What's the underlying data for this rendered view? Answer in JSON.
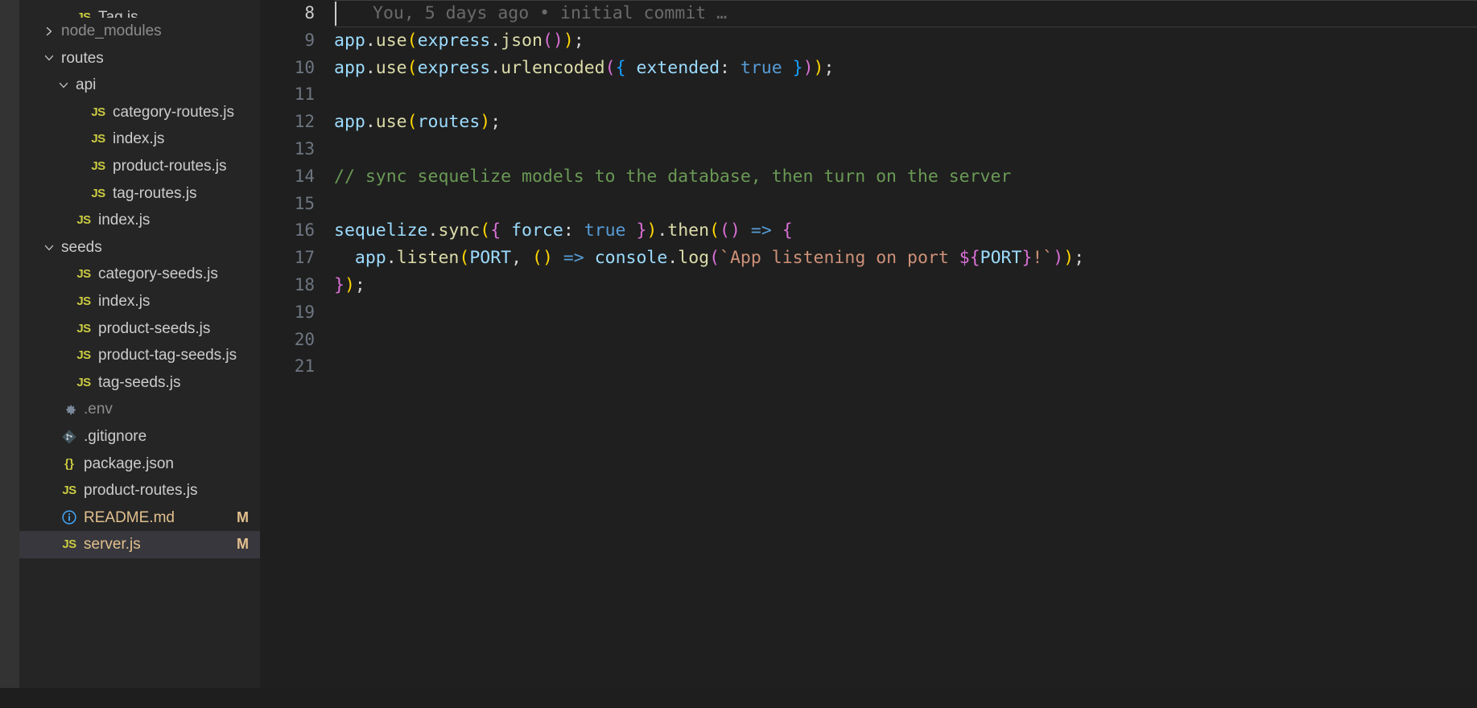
{
  "window": {
    "theme": "Dark+ (default dark)",
    "background": "#1e1e1e",
    "sidebar_background": "#252526",
    "editor_background": "#1f1f1f",
    "selection_background": "#37373d",
    "modified_badge_color": "#e2c08d",
    "accent_blue": "#0c7d9d"
  },
  "sidebar": {
    "name": "explorer-file-tree",
    "items": [
      {
        "label": "Tag.js",
        "icon": "js-file-icon",
        "indent": 2,
        "kind": "file",
        "badge": "",
        "state": ""
      },
      {
        "label": "node_modules",
        "icon": "chevron-right-icon",
        "indent": 1,
        "kind": "folder-collapsed",
        "badge": "",
        "state": "dim"
      },
      {
        "label": "routes",
        "icon": "chevron-down-icon",
        "indent": 1,
        "kind": "folder-expanded",
        "badge": "",
        "state": ""
      },
      {
        "label": "api",
        "icon": "chevron-down-icon",
        "indent": 2,
        "kind": "folder-expanded",
        "badge": "",
        "state": ""
      },
      {
        "label": "category-routes.js",
        "icon": "js-file-icon",
        "indent": 3,
        "kind": "file",
        "badge": "",
        "state": ""
      },
      {
        "label": "index.js",
        "icon": "js-file-icon",
        "indent": 3,
        "kind": "file",
        "badge": "",
        "state": ""
      },
      {
        "label": "product-routes.js",
        "icon": "js-file-icon",
        "indent": 3,
        "kind": "file",
        "badge": "",
        "state": ""
      },
      {
        "label": "tag-routes.js",
        "icon": "js-file-icon",
        "indent": 3,
        "kind": "file",
        "badge": "",
        "state": ""
      },
      {
        "label": "index.js",
        "icon": "js-file-icon",
        "indent": 2,
        "kind": "file",
        "badge": "",
        "state": ""
      },
      {
        "label": "seeds",
        "icon": "chevron-down-icon",
        "indent": 1,
        "kind": "folder-expanded",
        "badge": "",
        "state": ""
      },
      {
        "label": "category-seeds.js",
        "icon": "js-file-icon",
        "indent": 2,
        "kind": "file",
        "badge": "",
        "state": ""
      },
      {
        "label": "index.js",
        "icon": "js-file-icon",
        "indent": 2,
        "kind": "file",
        "badge": "",
        "state": ""
      },
      {
        "label": "product-seeds.js",
        "icon": "js-file-icon",
        "indent": 2,
        "kind": "file",
        "badge": "",
        "state": ""
      },
      {
        "label": "product-tag-seeds.js",
        "icon": "js-file-icon",
        "indent": 2,
        "kind": "file",
        "badge": "",
        "state": ""
      },
      {
        "label": "tag-seeds.js",
        "icon": "js-file-icon",
        "indent": 2,
        "kind": "file",
        "badge": "",
        "state": ""
      },
      {
        "label": ".env",
        "icon": "gear-icon",
        "indent": 1,
        "kind": "file",
        "badge": "",
        "state": "dim"
      },
      {
        "label": ".gitignore",
        "icon": "git-icon",
        "indent": 1,
        "kind": "file",
        "badge": "",
        "state": ""
      },
      {
        "label": "package.json",
        "icon": "json-braces-icon",
        "indent": 1,
        "kind": "file",
        "badge": "",
        "state": ""
      },
      {
        "label": "product-routes.js",
        "icon": "js-file-icon",
        "indent": 1,
        "kind": "file",
        "badge": "",
        "state": ""
      },
      {
        "label": "README.md",
        "icon": "info-circle-icon",
        "indent": 1,
        "kind": "file",
        "badge": "M",
        "state": "modified"
      },
      {
        "label": "server.js",
        "icon": "js-file-icon",
        "indent": 1,
        "kind": "file",
        "badge": "M",
        "state": "modified selected"
      }
    ]
  },
  "editor": {
    "name": "code-editor-server-js",
    "active_line": 8,
    "first_visible_line": 8,
    "lines": [
      {
        "number": "8",
        "active": true,
        "changed": false,
        "blame": "You, 5 days ago • initial commit …",
        "tokens": []
      },
      {
        "number": "9",
        "active": false,
        "changed": false,
        "tokens": [
          {
            "t": "app",
            "c": "t-var"
          },
          {
            "t": ".",
            "c": "t-plain"
          },
          {
            "t": "use",
            "c": "t-fn"
          },
          {
            "t": "(",
            "c": "t-p1"
          },
          {
            "t": "express",
            "c": "t-var"
          },
          {
            "t": ".",
            "c": "t-plain"
          },
          {
            "t": "json",
            "c": "t-fn"
          },
          {
            "t": "(",
            "c": "t-p2"
          },
          {
            "t": ")",
            "c": "t-p2"
          },
          {
            "t": ")",
            "c": "t-p1"
          },
          {
            "t": ";",
            "c": "t-plain"
          }
        ]
      },
      {
        "number": "10",
        "active": false,
        "changed": false,
        "tokens": [
          {
            "t": "app",
            "c": "t-var"
          },
          {
            "t": ".",
            "c": "t-plain"
          },
          {
            "t": "use",
            "c": "t-fn"
          },
          {
            "t": "(",
            "c": "t-p1"
          },
          {
            "t": "express",
            "c": "t-var"
          },
          {
            "t": ".",
            "c": "t-plain"
          },
          {
            "t": "urlencoded",
            "c": "t-fn"
          },
          {
            "t": "(",
            "c": "t-p2"
          },
          {
            "t": "{",
            "c": "t-p3"
          },
          {
            "t": " extended",
            "c": "t-var"
          },
          {
            "t": ": ",
            "c": "t-plain"
          },
          {
            "t": "true",
            "c": "t-kw"
          },
          {
            "t": " ",
            "c": "t-plain"
          },
          {
            "t": "}",
            "c": "t-p3"
          },
          {
            "t": ")",
            "c": "t-p2"
          },
          {
            "t": ")",
            "c": "t-p1"
          },
          {
            "t": ";",
            "c": "t-plain"
          }
        ]
      },
      {
        "number": "11",
        "active": false,
        "changed": false,
        "tokens": []
      },
      {
        "number": "12",
        "active": false,
        "changed": false,
        "tokens": [
          {
            "t": "app",
            "c": "t-var"
          },
          {
            "t": ".",
            "c": "t-plain"
          },
          {
            "t": "use",
            "c": "t-fn"
          },
          {
            "t": "(",
            "c": "t-p1"
          },
          {
            "t": "routes",
            "c": "t-var"
          },
          {
            "t": ")",
            "c": "t-p1"
          },
          {
            "t": ";",
            "c": "t-plain"
          }
        ]
      },
      {
        "number": "13",
        "active": false,
        "changed": false,
        "tokens": []
      },
      {
        "number": "14",
        "active": false,
        "changed": false,
        "tokens": [
          {
            "t": "// sync sequelize models to the database, then turn on the server",
            "c": "t-comment"
          }
        ]
      },
      {
        "number": "15",
        "active": false,
        "changed": false,
        "tokens": []
      },
      {
        "number": "16",
        "active": false,
        "changed": true,
        "tokens": [
          {
            "t": "sequelize",
            "c": "t-var"
          },
          {
            "t": ".",
            "c": "t-plain"
          },
          {
            "t": "sync",
            "c": "t-fn"
          },
          {
            "t": "(",
            "c": "t-p1"
          },
          {
            "t": "{",
            "c": "t-p2"
          },
          {
            "t": " force",
            "c": "t-var"
          },
          {
            "t": ": ",
            "c": "t-plain"
          },
          {
            "t": "true",
            "c": "t-kw"
          },
          {
            "t": " ",
            "c": "t-plain"
          },
          {
            "t": "}",
            "c": "t-p2"
          },
          {
            "t": ")",
            "c": "t-p1"
          },
          {
            "t": ".",
            "c": "t-plain"
          },
          {
            "t": "then",
            "c": "t-fn"
          },
          {
            "t": "(",
            "c": "t-p1"
          },
          {
            "t": "(",
            "c": "t-p2"
          },
          {
            "t": ")",
            "c": "t-p2"
          },
          {
            "t": " ",
            "c": "t-plain"
          },
          {
            "t": "=>",
            "c": "t-arrow"
          },
          {
            "t": " ",
            "c": "t-plain"
          },
          {
            "t": "{",
            "c": "t-p2"
          }
        ]
      },
      {
        "number": "17",
        "active": false,
        "changed": false,
        "tokens": [
          {
            "t": "  ",
            "c": "t-plain"
          },
          {
            "t": "app",
            "c": "t-var"
          },
          {
            "t": ".",
            "c": "t-plain"
          },
          {
            "t": "listen",
            "c": "t-fn"
          },
          {
            "t": "(",
            "c": "t-p1"
          },
          {
            "t": "PORT",
            "c": "t-var"
          },
          {
            "t": ", ",
            "c": "t-plain"
          },
          {
            "t": "(",
            "c": "t-p1"
          },
          {
            "t": ")",
            "c": "t-p1"
          },
          {
            "t": " ",
            "c": "t-plain"
          },
          {
            "t": "=>",
            "c": "t-arrow"
          },
          {
            "t": " ",
            "c": "t-plain"
          },
          {
            "t": "console",
            "c": "t-var"
          },
          {
            "t": ".",
            "c": "t-plain"
          },
          {
            "t": "log",
            "c": "t-fn"
          },
          {
            "t": "(",
            "c": "t-p2"
          },
          {
            "t": "`App listening on port ",
            "c": "t-str"
          },
          {
            "t": "${",
            "c": "t-p2"
          },
          {
            "t": "PORT",
            "c": "t-var"
          },
          {
            "t": "}",
            "c": "t-p2"
          },
          {
            "t": "!`",
            "c": "t-str"
          },
          {
            "t": ")",
            "c": "t-p2"
          },
          {
            "t": ")",
            "c": "t-p1"
          },
          {
            "t": ";",
            "c": "t-plain"
          }
        ]
      },
      {
        "number": "18",
        "active": false,
        "changed": false,
        "tokens": [
          {
            "t": "}",
            "c": "t-p2"
          },
          {
            "t": ")",
            "c": "t-p1"
          },
          {
            "t": ";",
            "c": "t-plain"
          }
        ]
      },
      {
        "number": "19",
        "active": false,
        "changed": false,
        "tokens": []
      },
      {
        "number": "20",
        "active": false,
        "changed": false,
        "tokens": []
      },
      {
        "number": "21",
        "active": false,
        "changed": false,
        "tokens": []
      }
    ]
  }
}
